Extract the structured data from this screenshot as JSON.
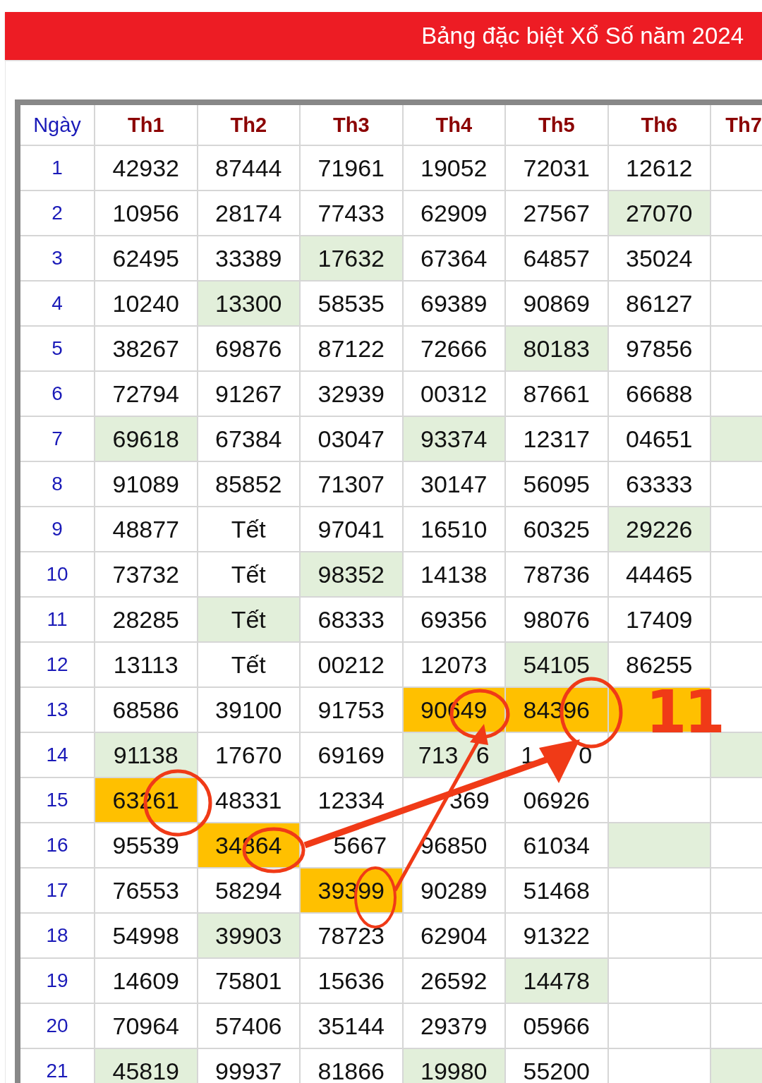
{
  "header": {
    "title": "Bảng đặc biệt Xổ Số năm 2024"
  },
  "table": {
    "columns": [
      "Ngày",
      "Th1",
      "Th2",
      "Th3",
      "Th4",
      "Th5",
      "Th6",
      "Th7"
    ],
    "rows": [
      {
        "cells": [
          {
            "value": "1"
          },
          {
            "value": "42932"
          },
          {
            "value": "87444"
          },
          {
            "value": "71961"
          },
          {
            "value": "19052"
          },
          {
            "value": "72031"
          },
          {
            "value": "12612"
          },
          null
        ]
      },
      {
        "cells": [
          {
            "value": "2"
          },
          {
            "value": "10956"
          },
          {
            "value": "28174"
          },
          {
            "value": "77433"
          },
          {
            "value": "62909"
          },
          {
            "value": "27567"
          },
          {
            "value": "27070",
            "color": "#e2efda"
          },
          null
        ]
      },
      {
        "cells": [
          {
            "value": "3"
          },
          {
            "value": "62495"
          },
          {
            "value": "33389"
          },
          {
            "value": "17632",
            "color": "#e2efda"
          },
          {
            "value": "67364"
          },
          {
            "value": "64857"
          },
          {
            "value": "35024"
          },
          null
        ]
      },
      {
        "cells": [
          {
            "value": "4"
          },
          {
            "value": "10240"
          },
          {
            "value": "13300",
            "color": "#e2efda"
          },
          {
            "value": "58535"
          },
          {
            "value": "69389"
          },
          {
            "value": "90869"
          },
          {
            "value": "86127"
          },
          null
        ]
      },
      {
        "cells": [
          {
            "value": "5"
          },
          {
            "value": "38267"
          },
          {
            "value": "69876"
          },
          {
            "value": "87122"
          },
          {
            "value": "72666"
          },
          {
            "value": "80183",
            "color": "#e2efda"
          },
          {
            "value": "97856"
          },
          null
        ]
      },
      {
        "cells": [
          {
            "value": "6"
          },
          {
            "value": "72794"
          },
          {
            "value": "91267"
          },
          {
            "value": "32939"
          },
          {
            "value": "00312"
          },
          {
            "value": "87661"
          },
          {
            "value": "66688"
          },
          null
        ]
      },
      {
        "cells": [
          {
            "value": "7"
          },
          {
            "value": "69618",
            "color": "#e2efda"
          },
          {
            "value": "67384"
          },
          {
            "value": "03047"
          },
          {
            "value": "93374",
            "color": "#e2efda"
          },
          {
            "value": "12317"
          },
          {
            "value": "04651"
          },
          {
            "color": "#e2efda"
          }
        ]
      },
      {
        "cells": [
          {
            "value": "8"
          },
          {
            "value": "91089"
          },
          {
            "value": "85852"
          },
          {
            "value": "71307"
          },
          {
            "value": "30147"
          },
          {
            "value": "56095"
          },
          {
            "value": "63333"
          },
          null
        ]
      },
      {
        "cells": [
          {
            "value": "9"
          },
          {
            "value": "48877"
          },
          {
            "value": "Tết"
          },
          {
            "value": "97041"
          },
          {
            "value": "16510"
          },
          {
            "value": "60325"
          },
          {
            "value": "29226",
            "color": "#e2efda"
          },
          null
        ]
      },
      {
        "cells": [
          {
            "value": "10"
          },
          {
            "value": "73732"
          },
          {
            "value": "Tết"
          },
          {
            "value": "98352",
            "color": "#e2efda"
          },
          {
            "value": "14138"
          },
          {
            "value": "78736"
          },
          {
            "value": "44465"
          },
          null
        ]
      },
      {
        "cells": [
          {
            "value": "11"
          },
          {
            "value": "28285"
          },
          {
            "value": "Tết",
            "color": "#e2efda"
          },
          {
            "value": "68333"
          },
          {
            "value": "69356"
          },
          {
            "value": "98076"
          },
          {
            "value": "17409"
          },
          null
        ]
      },
      {
        "cells": [
          {
            "value": "12"
          },
          {
            "value": "13113"
          },
          {
            "value": "Tết"
          },
          {
            "value": "00212"
          },
          {
            "value": "12073"
          },
          {
            "value": "54105",
            "color": "#e2efda"
          },
          {
            "value": "86255"
          },
          null
        ]
      },
      {
        "cells": [
          {
            "value": "13"
          },
          {
            "value": "68586"
          },
          {
            "value": "39100"
          },
          {
            "value": "91753"
          },
          {
            "value": "90649",
            "color": "#ffc000"
          },
          {
            "value": "84396",
            "color": "#ffc000"
          },
          {
            "color": "#ffc000"
          },
          null
        ]
      },
      {
        "cells": [
          {
            "value": "14"
          },
          {
            "value": "91138",
            "color": "#e2efda"
          },
          {
            "value": "17670"
          },
          {
            "value": "69169"
          },
          {
            "fragments": [
              "713",
              "6"
            ],
            "color": "#e2efda"
          },
          {
            "fragments": [
              "1",
              "0"
            ]
          },
          null,
          {
            "color": "#e2efda"
          }
        ]
      },
      {
        "cells": [
          {
            "value": "15"
          },
          {
            "value": "63261",
            "color": "#ffc000"
          },
          {
            "value": "48331"
          },
          {
            "value": "12334"
          },
          {
            "fragments": [
              "369"
            ]
          },
          {
            "value": "06926"
          },
          null,
          null
        ]
      },
      {
        "cells": [
          {
            "value": "16"
          },
          {
            "value": "95539"
          },
          {
            "value": "34864",
            "color": "#ffc000"
          },
          {
            "fragments": [
              "5667"
            ]
          },
          {
            "value": "96850"
          },
          {
            "value": "61034"
          },
          {
            "color": "#e2efda"
          },
          null
        ]
      },
      {
        "cells": [
          {
            "value": "17"
          },
          {
            "value": "76553"
          },
          {
            "value": "58294"
          },
          {
            "value": "39399",
            "color": "#ffc000"
          },
          {
            "value": "90289"
          },
          {
            "value": "51468"
          },
          null,
          null
        ]
      },
      {
        "cells": [
          {
            "value": "18"
          },
          {
            "value": "54998"
          },
          {
            "value": "39903",
            "color": "#e2efda"
          },
          {
            "value": "78723"
          },
          {
            "value": "62904"
          },
          {
            "value": "91322"
          },
          null,
          null
        ]
      },
      {
        "cells": [
          {
            "value": "19"
          },
          {
            "value": "14609"
          },
          {
            "value": "75801"
          },
          {
            "value": "15636"
          },
          {
            "value": "26592"
          },
          {
            "value": "14478",
            "color": "#e2efda"
          },
          null,
          null
        ]
      },
      {
        "cells": [
          {
            "value": "20"
          },
          {
            "value": "70964"
          },
          {
            "value": "57406"
          },
          {
            "value": "35144"
          },
          {
            "value": "29379"
          },
          {
            "value": "05966"
          },
          null,
          null
        ]
      },
      {
        "cells": [
          {
            "value": "21"
          },
          {
            "value": "45819",
            "color": "#e2efda"
          },
          {
            "value": "99937"
          },
          {
            "value": "81866"
          },
          {
            "value": "19980",
            "color": "#e2efda"
          },
          {
            "value": "55200"
          },
          null,
          {
            "color": "#e2efda"
          }
        ]
      }
    ]
  },
  "annotation": {
    "label": "11"
  }
}
